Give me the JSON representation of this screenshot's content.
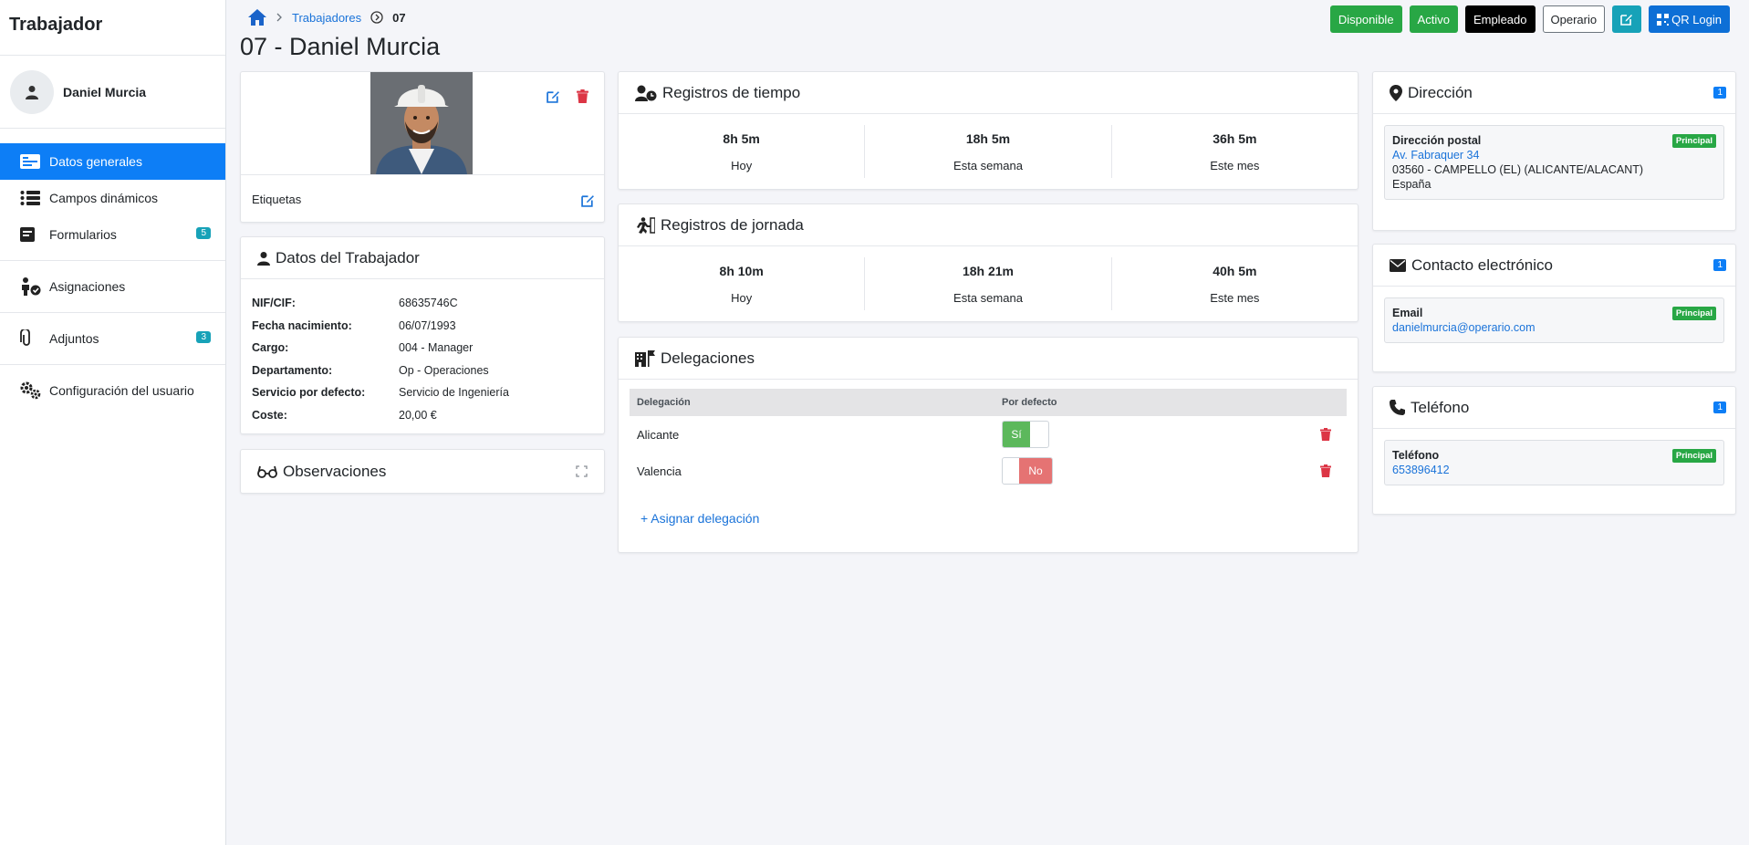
{
  "sidebar": {
    "title": "Trabajador",
    "user_name": "Daniel Murcia",
    "items": [
      {
        "label": "Datos generales"
      },
      {
        "label": "Campos dinámicos"
      },
      {
        "label": "Formularios",
        "badge": "5"
      },
      {
        "label": "Asignaciones"
      },
      {
        "label": "Adjuntos",
        "badge": "3"
      },
      {
        "label": "Configuración del usuario"
      }
    ]
  },
  "breadcrumb": {
    "parent": "Trabajadores",
    "current": "07"
  },
  "page_title": "07 - Daniel Murcia",
  "actions": {
    "disponible": "Disponible",
    "activo": "Activo",
    "empleado": "Empleado",
    "operario": "Operario",
    "qr_login": "QR Login"
  },
  "photo_card": {
    "tags_label": "Etiquetas"
  },
  "worker": {
    "title": "Datos del Trabajador",
    "fields": [
      {
        "k": "NIF/CIF:",
        "v": "68635746C"
      },
      {
        "k": "Fecha nacimiento:",
        "v": "06/07/1993"
      },
      {
        "k": "Cargo:",
        "v": "004 - Manager"
      },
      {
        "k": "Departamento:",
        "v": "Op - Operaciones"
      },
      {
        "k": "Servicio por defecto:",
        "v": "Servicio de Ingeniería"
      },
      {
        "k": "Coste:",
        "v": "20,00 €"
      }
    ]
  },
  "observaciones": {
    "title": "Observaciones"
  },
  "tiempo": {
    "title": "Registros de tiempo",
    "stats": [
      {
        "v": "8h 5m",
        "l": "Hoy"
      },
      {
        "v": "18h 5m",
        "l": "Esta semana"
      },
      {
        "v": "36h 5m",
        "l": "Este mes"
      }
    ]
  },
  "jornada": {
    "title": "Registros de jornada",
    "stats": [
      {
        "v": "8h 10m",
        "l": "Hoy"
      },
      {
        "v": "18h 21m",
        "l": "Esta semana"
      },
      {
        "v": "40h 5m",
        "l": "Este mes"
      }
    ]
  },
  "delegaciones": {
    "title": "Delegaciones",
    "col_delegacion": "Delegación",
    "col_defecto": "Por defecto",
    "rows": [
      {
        "name": "Alicante",
        "toggle": "Sí"
      },
      {
        "name": "Valencia",
        "toggle": "No"
      }
    ],
    "assign": "+ Asignar delegación"
  },
  "direccion": {
    "title": "Dirección",
    "count": "1",
    "type": "Dirección postal",
    "badge": "Principal",
    "street": "Av. Fabraquer 34",
    "city": "03560 - CAMPELLO (EL) (ALICANTE/ALACANT)",
    "country": "España"
  },
  "contacto": {
    "title": "Contacto electrónico",
    "count": "1",
    "type": "Email",
    "badge": "Principal",
    "email": "danielmurcia@operario.com"
  },
  "telefono": {
    "title": "Teléfono",
    "count": "1",
    "type": "Teléfono",
    "badge": "Principal",
    "number": "653896412"
  },
  "colors": {
    "primary": "#0d7ef6",
    "success": "#28a745",
    "danger": "#dc3545",
    "info": "#17a2b8"
  }
}
